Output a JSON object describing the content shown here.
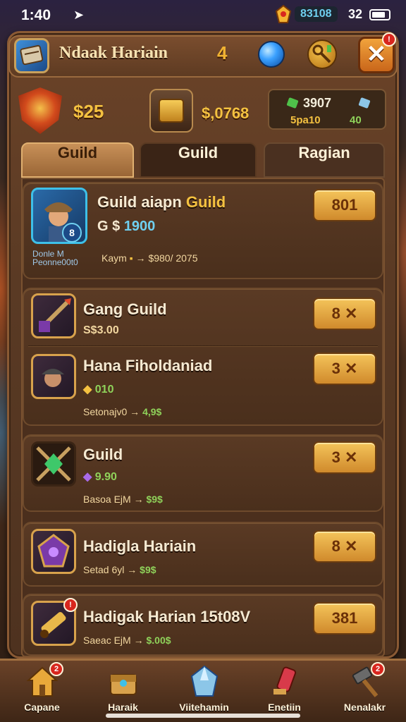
{
  "status_bar": {
    "time": "1:40",
    "pill": "83108",
    "battery": "32"
  },
  "header": {
    "title": "Ndaak Hariain",
    "count": "4",
    "close_label": "✕"
  },
  "resources": {
    "money": "$25",
    "gold": "$,0768",
    "r1": "3907",
    "r2": "5pa10",
    "r3": "40"
  },
  "tabs": [
    {
      "label": "Guild"
    },
    {
      "label": "Guild"
    },
    {
      "label": "Ragian"
    }
  ],
  "featured": {
    "title": "Guild aiapn",
    "title_accent": "Guild",
    "sub_prefix": "G $",
    "sub_value": "1900",
    "avatar_badge": "8",
    "owner_line1": "Donle M",
    "owner_line2": "Peonne00t0",
    "info_prefix": "Kaym",
    "info_value": "$980/ 2075",
    "button": "801"
  },
  "cards": [
    {
      "title": "Gang Guild",
      "sub": "S$3.00",
      "info_prefix": "",
      "info_value": "",
      "button": "8 ✕"
    },
    {
      "title": "Hana Fiholdaniad",
      "sub": "010",
      "info_prefix": "Setonajv0 →",
      "info_value": "4,9$",
      "button": "3 ✕"
    },
    {
      "title": "Guild",
      "sub": "9.90",
      "info_prefix": "Basoa EjM →",
      "info_value": "$9$",
      "button": "3 ✕"
    },
    {
      "title": "Hadigla Hariain",
      "sub": "",
      "info_prefix": "Setad 6yl →",
      "info_value": "$9$",
      "button": "8 ✕"
    },
    {
      "title": "Hadigak Harian 15t08V",
      "sub": "",
      "info_prefix": "Saeac EjM →",
      "info_value": "$.00$",
      "button": "381"
    }
  ],
  "nav": [
    {
      "label": "Capane",
      "icon": "house-icon"
    },
    {
      "label": "Haraik",
      "icon": "chest-icon"
    },
    {
      "label": "Viitehamin",
      "icon": "crystal-icon"
    },
    {
      "label": "Enetiin",
      "icon": "potion-icon"
    },
    {
      "label": "Nenalakr",
      "icon": "hammer-icon"
    }
  ],
  "badges": {
    "close": "!",
    "nav_home": "2",
    "nav_crystal": "",
    "nav_hammer": "2"
  }
}
